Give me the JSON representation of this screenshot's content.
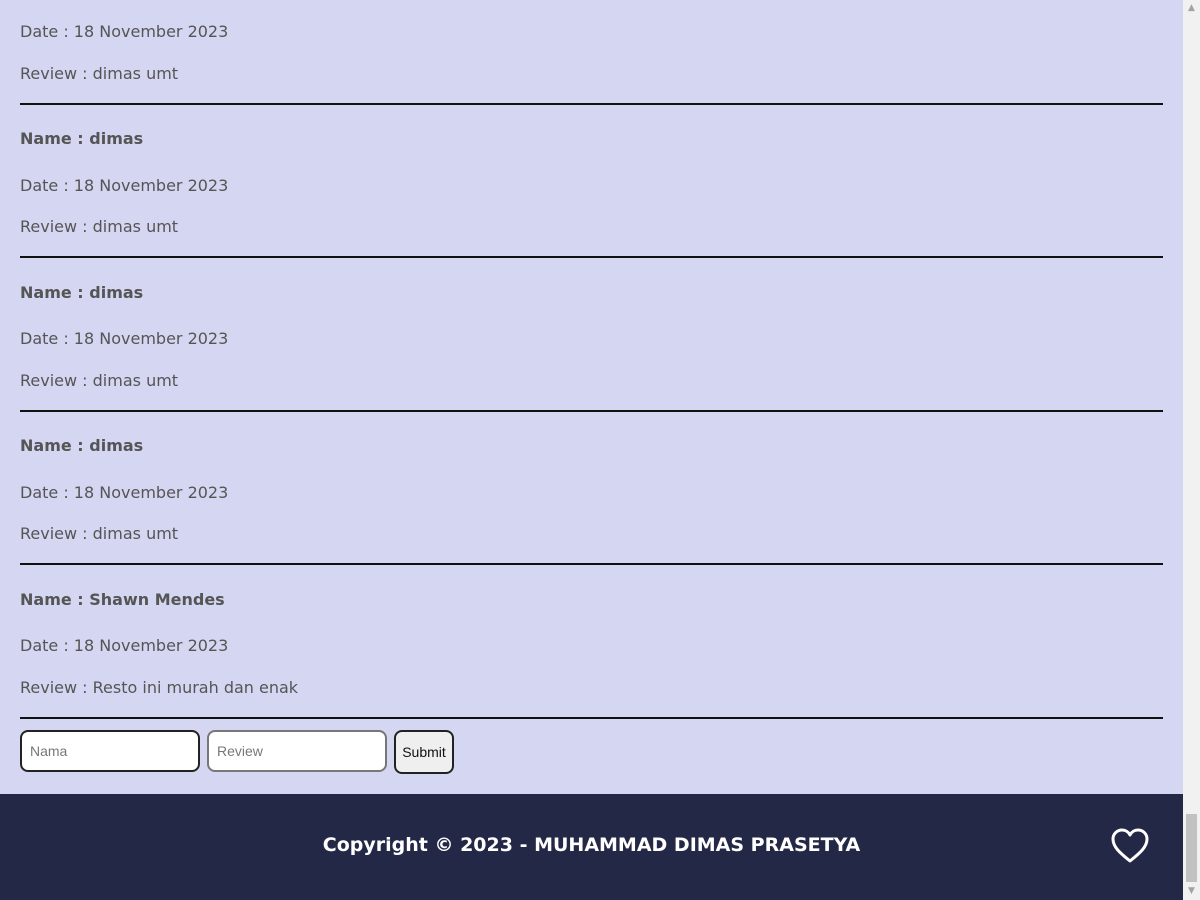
{
  "reviews": [
    {
      "name_label": "",
      "date_label": "Date : 18 November 2023",
      "review_label": "Review : dimas umt"
    },
    {
      "name_label": "Name : dimas",
      "date_label": "Date : 18 November 2023",
      "review_label": "Review : dimas umt"
    },
    {
      "name_label": "Name : dimas",
      "date_label": "Date : 18 November 2023",
      "review_label": "Review : dimas umt"
    },
    {
      "name_label": "Name : dimas",
      "date_label": "Date : 18 November 2023",
      "review_label": "Review : dimas umt"
    },
    {
      "name_label": "Name : Shawn Mendes",
      "date_label": "Date : 18 November 2023",
      "review_label": "Review : Resto ini murah dan enak"
    }
  ],
  "form": {
    "name_placeholder": "Nama",
    "name_value": "",
    "review_placeholder": "Review",
    "review_value": "",
    "submit_label": "Submit"
  },
  "footer": {
    "copyright": "Copyright © 2023 - MUHAMMAD DIMAS PRASETYA",
    "favorite_icon": "heart-outline-icon"
  },
  "colors": {
    "background": "#d4d6f2",
    "footer_background": "#242847",
    "text": "#555555",
    "divider": "#111111"
  }
}
